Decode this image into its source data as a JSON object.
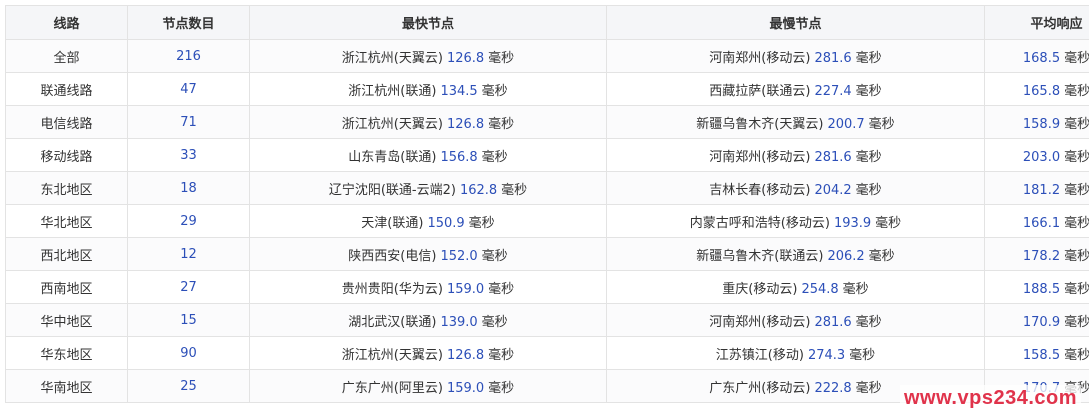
{
  "table": {
    "headers": {
      "line": "线路",
      "count": "节点数目",
      "fastest": "最快节点",
      "slowest": "最慢节点",
      "average": "平均响应"
    },
    "unit": "毫秒",
    "rows": [
      {
        "line": "全部",
        "count": "216",
        "fast_node": "浙江杭州(天翼云)",
        "fast_ms": "126.8",
        "slow_node": "河南郑州(移动云)",
        "slow_ms": "281.6",
        "avg_ms": "168.5"
      },
      {
        "line": "联通线路",
        "count": "47",
        "fast_node": "浙江杭州(联通)",
        "fast_ms": "134.5",
        "slow_node": "西藏拉萨(联通云)",
        "slow_ms": "227.4",
        "avg_ms": "165.8"
      },
      {
        "line": "电信线路",
        "count": "71",
        "fast_node": "浙江杭州(天翼云)",
        "fast_ms": "126.8",
        "slow_node": "新疆乌鲁木齐(天翼云)",
        "slow_ms": "200.7",
        "avg_ms": "158.9"
      },
      {
        "line": "移动线路",
        "count": "33",
        "fast_node": "山东青岛(联通)",
        "fast_ms": "156.8",
        "slow_node": "河南郑州(移动云)",
        "slow_ms": "281.6",
        "avg_ms": "203.0"
      },
      {
        "line": "东北地区",
        "count": "18",
        "fast_node": "辽宁沈阳(联通-云端2)",
        "fast_ms": "162.8",
        "slow_node": "吉林长春(移动云)",
        "slow_ms": "204.2",
        "avg_ms": "181.2"
      },
      {
        "line": "华北地区",
        "count": "29",
        "fast_node": "天津(联通)",
        "fast_ms": "150.9",
        "slow_node": "内蒙古呼和浩特(移动云)",
        "slow_ms": "193.9",
        "avg_ms": "166.1"
      },
      {
        "line": "西北地区",
        "count": "12",
        "fast_node": "陕西西安(电信)",
        "fast_ms": "152.0",
        "slow_node": "新疆乌鲁木齐(联通云)",
        "slow_ms": "206.2",
        "avg_ms": "178.2"
      },
      {
        "line": "西南地区",
        "count": "27",
        "fast_node": "贵州贵阳(华为云)",
        "fast_ms": "159.0",
        "slow_node": "重庆(移动云)",
        "slow_ms": "254.8",
        "avg_ms": "188.5"
      },
      {
        "line": "华中地区",
        "count": "15",
        "fast_node": "湖北武汉(联通)",
        "fast_ms": "139.0",
        "slow_node": "河南郑州(移动云)",
        "slow_ms": "281.6",
        "avg_ms": "170.9"
      },
      {
        "line": "华东地区",
        "count": "90",
        "fast_node": "浙江杭州(天翼云)",
        "fast_ms": "126.8",
        "slow_node": "江苏镇江(移动)",
        "slow_ms": "274.3",
        "avg_ms": "158.5"
      },
      {
        "line": "华南地区",
        "count": "25",
        "fast_node": "广东广州(阿里云)",
        "fast_ms": "159.0",
        "slow_node": "广东广州(移动云)",
        "slow_ms": "222.8",
        "avg_ms": "170.7"
      }
    ]
  },
  "watermark": "www.vps234.com",
  "colors": {
    "number": "#2c4fb8",
    "header_bg": "#f5f6f8",
    "border": "#e3e3e3",
    "watermark": "#e0334b"
  }
}
